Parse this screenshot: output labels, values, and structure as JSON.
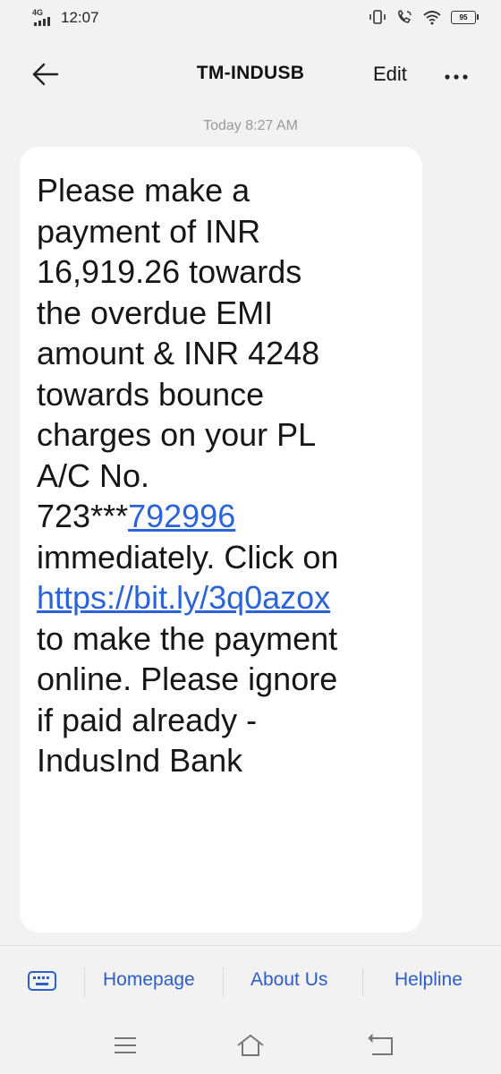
{
  "status_bar": {
    "network": "4G",
    "time": "12:07",
    "battery": "95"
  },
  "header": {
    "title": "TM-INDUSB",
    "edit_label": "Edit"
  },
  "conversation": {
    "timestamp": "Today 8:27 AM",
    "message": {
      "text_before_account": "Please make a\npayment of INR\n16,919.26 towards\nthe overdue EMI\namount & INR 4248\ntowards bounce\ncharges on your PL\nA/C No.\n723***",
      "account_link": "792996",
      "text_middle": "\nimmediately. Click on\n",
      "url_link": "https://bit.ly/3q0azox",
      "text_after": "\nto make the payment\nonline. Please ignore\nif paid already -\nIndusInd Bank"
    }
  },
  "menu": {
    "items": [
      "Homepage",
      "About Us",
      "Helpline"
    ]
  },
  "colors": {
    "link": "#2b63d9",
    "menu_text": "#2e5dc9",
    "background": "#f2f2f2"
  }
}
